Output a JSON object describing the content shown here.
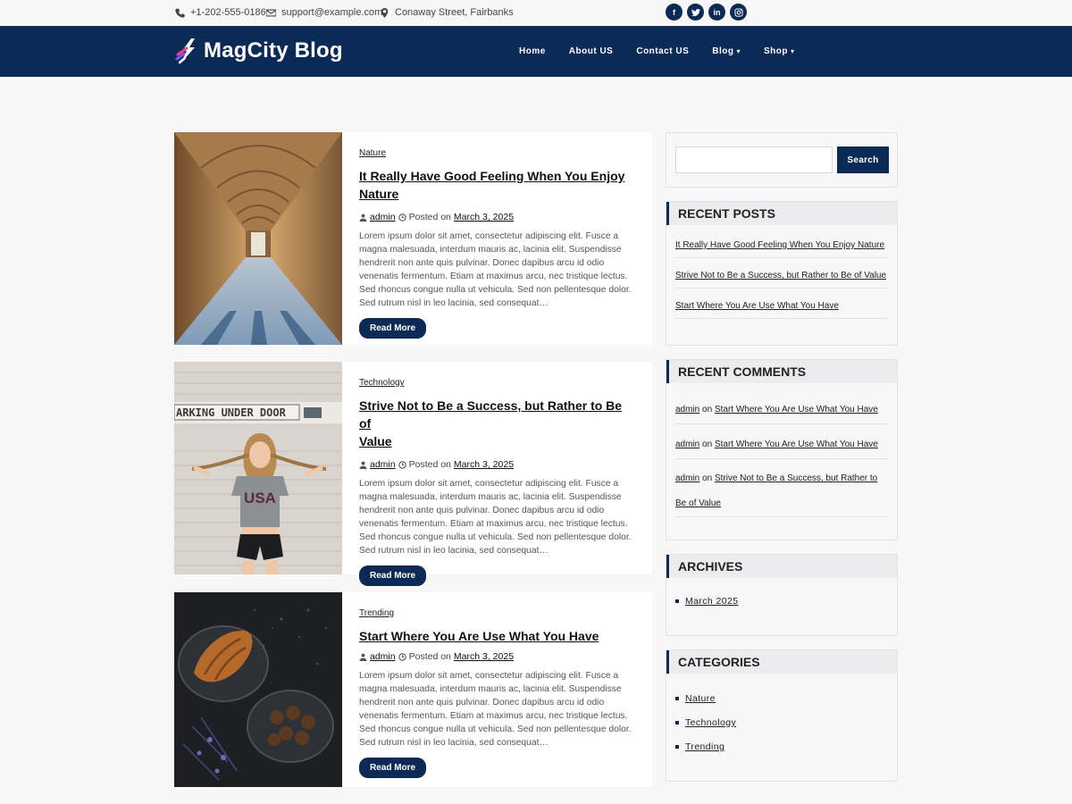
{
  "topbar": {
    "phone": "+1-202-555-0186",
    "email": "support@example.com",
    "address": "Conaway Street, Fairbanks",
    "socials": [
      {
        "name": "facebook",
        "glyph": "f"
      },
      {
        "name": "twitter",
        "glyph": "t"
      },
      {
        "name": "linkedin",
        "glyph": "in"
      },
      {
        "name": "instagram",
        "glyph": "◎"
      }
    ]
  },
  "header": {
    "logo_text": "MagCity Blog",
    "nav": [
      "Home",
      "About US",
      "Contact US",
      "Blog",
      "Shop"
    ]
  },
  "posts": [
    {
      "category": "Nature",
      "title_line1": "It Really Have Good Feeling When You Enjoy",
      "title_line2": "Nature",
      "author": "admin",
      "posted_on": "Posted on",
      "date": "March 3, 2025",
      "excerpt": "Lorem ipsum dolor sit amet, consectetur adipiscing elit. Fusce a magna malesuada, interdum mauris ac, lacinia elit. Suspendisse hendrerit non ante quis pulvinar. Donec dapibus arcu id odio venenatis fermentum. Etiam at maximus arcu, nec tristique lectus. Sed rhoncus congue nulla ut vehicula. Sed non pellentesque dolor. Sed rutrum nisl in leo lacinia, sed consequat…",
      "read_more": "Read More"
    },
    {
      "category": "Technology",
      "title_line1": "Strive Not to Be a Success, but Rather to Be of",
      "title_line2": "Value",
      "author": "admin",
      "posted_on": "Posted on",
      "date": "March 3, 2025",
      "excerpt": "Lorem ipsum dolor sit amet, consectetur adipiscing elit. Fusce a magna malesuada, interdum mauris ac, lacinia elit. Suspendisse hendrerit non ante quis pulvinar. Donec dapibus arcu id odio venenatis fermentum. Etiam at maximus arcu, nec tristique lectus. Sed rhoncus congue nulla ut vehicula. Sed non pellentesque dolor. Sed rutrum nisl in leo lacinia, sed consequat…",
      "read_more": "Read More",
      "image_sign": "ARKING UNDER DOOR",
      "shirt_text": "USA"
    },
    {
      "category": "Trending",
      "title_line1": "Start Where You Are Use What You Have",
      "title_line2": "",
      "author": "admin",
      "posted_on": "Posted on",
      "date": "March 3, 2025",
      "excerpt": "Lorem ipsum dolor sit amet, consectetur adipiscing elit. Fusce a magna malesuada, interdum mauris ac, lacinia elit. Suspendisse hendrerit non ante quis pulvinar. Donec dapibus arcu id odio venenatis fermentum. Etiam at maximus arcu, nec tristique lectus. Sed rhoncus congue nulla ut vehicula. Sed non pellentesque dolor. Sed rutrum nisl in leo lacinia, sed consequat…",
      "read_more": "Read More"
    }
  ],
  "sidebar": {
    "search_button": "Search",
    "search_value": "",
    "recent_posts": {
      "title": "RECENT POSTS",
      "items": [
        "It Really Have Good Feeling When You Enjoy Nature",
        "Strive Not to Be a Success, but Rather to Be of Value",
        "Start Where You Are Use What You Have"
      ]
    },
    "recent_comments": {
      "title": "RECENT COMMENTS",
      "on": "on",
      "items": [
        {
          "author": "admin",
          "post": "Start Where You Are Use What You Have"
        },
        {
          "author": "admin",
          "post": "Start Where You Are Use What You Have"
        },
        {
          "author": "admin",
          "post_line1": "Strive Not to Be a Success, but Rather to",
          "post_line2": "Be of Value"
        }
      ]
    },
    "archives": {
      "title": "ARCHIVES",
      "items": [
        "March 2025"
      ]
    },
    "categories": {
      "title": "CATEGORIES",
      "items": [
        "Nature",
        "Technology",
        "Trending"
      ]
    }
  },
  "colors": {
    "brand_navy": "#0b2a55",
    "page_bg": "#f7f7f8"
  }
}
